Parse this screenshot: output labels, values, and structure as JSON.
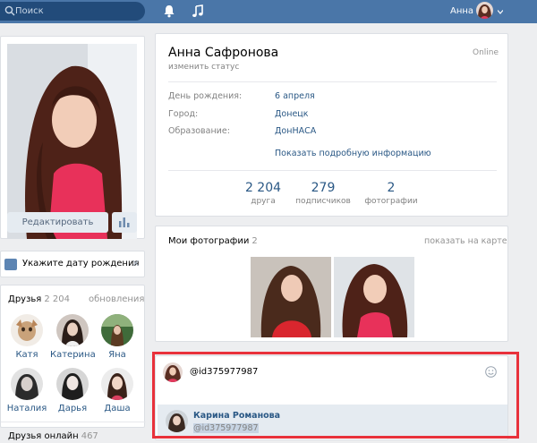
{
  "topbar": {
    "search_placeholder": "Поиск",
    "user_name": "Анна",
    "icons": [
      "search-icon",
      "bell-icon",
      "music-icon",
      "chevron-down-icon"
    ]
  },
  "sidebar": {
    "edit_button": "Редактировать",
    "birthday_prompt": "Укажите дату рождения",
    "close_glyph": "✕",
    "friends": {
      "title": "Друзья",
      "count": "2 204",
      "updates": "обновления",
      "items": [
        {
          "name": "Катя"
        },
        {
          "name": "Катерина"
        },
        {
          "name": "Яна"
        },
        {
          "name": "Наталия"
        },
        {
          "name": "Дарья"
        },
        {
          "name": "Даша"
        }
      ]
    },
    "online": {
      "title": "Друзья онлайн",
      "count": "467"
    }
  },
  "profile": {
    "name": "Анна Сафронова",
    "status_prompt": "изменить статус",
    "online": "Online",
    "rows": [
      {
        "label": "День рождения:",
        "value": "6 апреля"
      },
      {
        "label": "Город:",
        "value": "Донецк"
      },
      {
        "label": "Образование:",
        "value": "ДонНАСА"
      }
    ],
    "more_info": "Показать подробную информацию",
    "counters": [
      {
        "num": "2 204",
        "label": "друга"
      },
      {
        "num": "279",
        "label": "подписчиков"
      },
      {
        "num": "2",
        "label": "фотографии"
      }
    ]
  },
  "photos": {
    "title": "Мои фотографии",
    "count": "2",
    "map_link": "показать на карте"
  },
  "post": {
    "text": "@id375977987",
    "mention_name": "Карина Романова",
    "mention_id": "@id375977987"
  },
  "colors": {
    "header": "#4a76a8",
    "link": "#2a5885",
    "highlight": "#e8313b",
    "page_bg": "#edeef0"
  }
}
